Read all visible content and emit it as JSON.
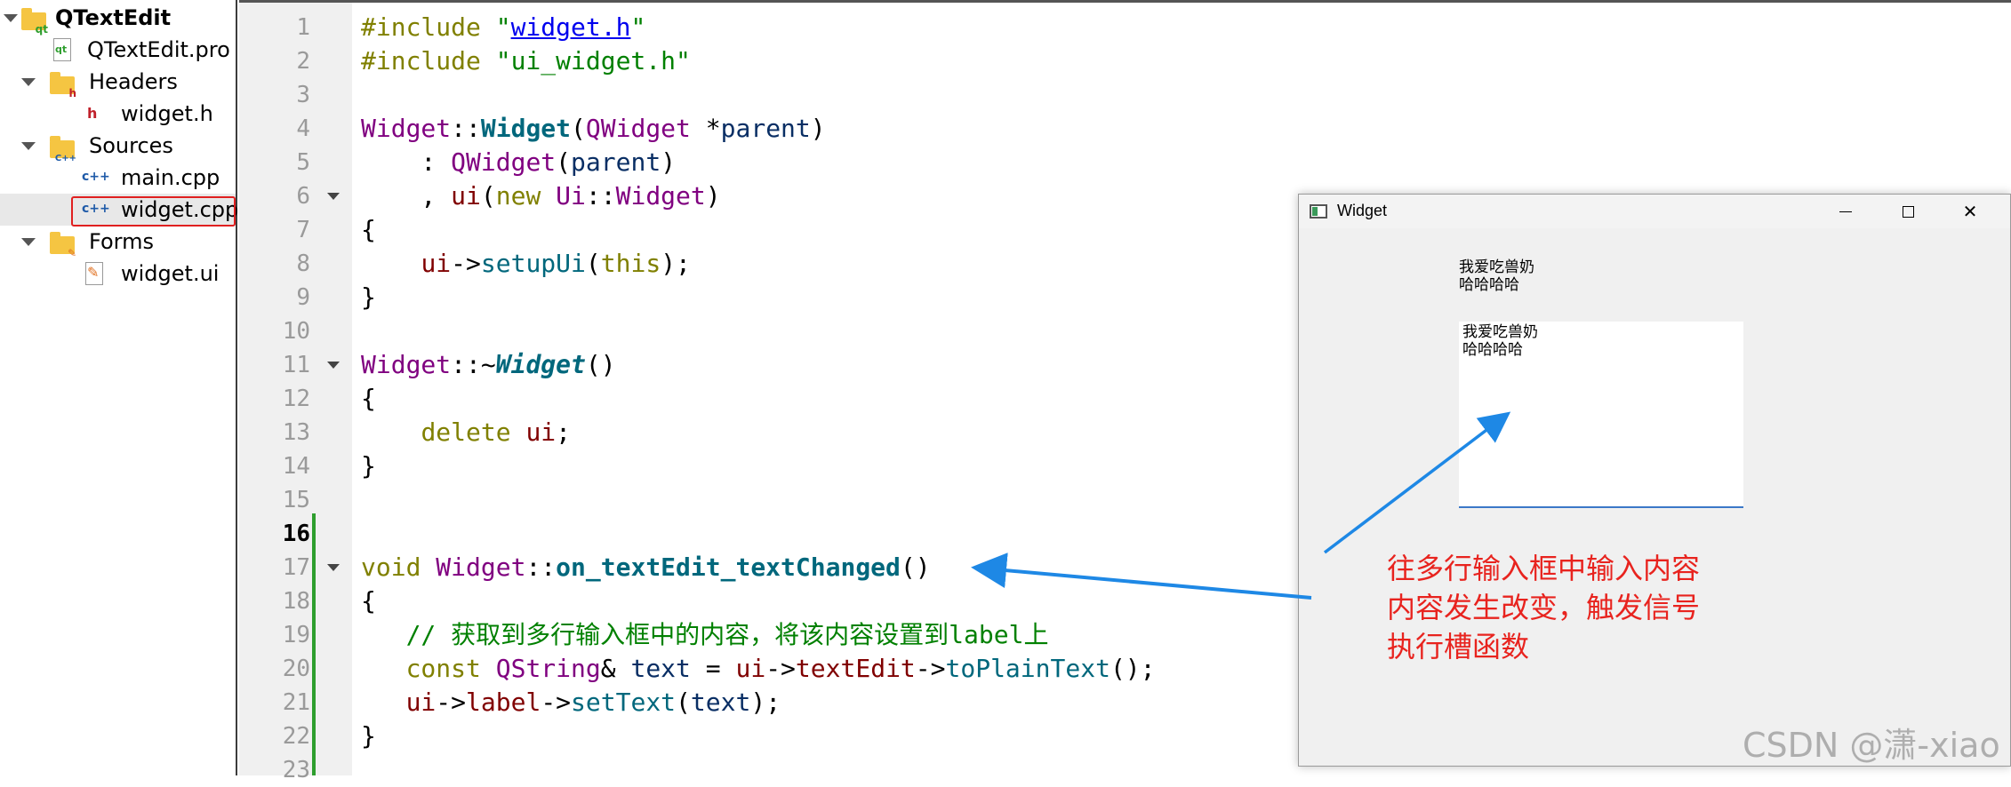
{
  "project_tree": {
    "items": [
      {
        "label": "QTextEdit",
        "kind": "project",
        "icon": "qt-folder-icon"
      },
      {
        "label": "QTextEdit.pro",
        "kind": "file",
        "icon": "qt-project-file-icon"
      },
      {
        "label": "Headers",
        "kind": "folder",
        "icon": "headers-folder-icon"
      },
      {
        "label": "widget.h",
        "kind": "file",
        "icon": "header-file-icon"
      },
      {
        "label": "Sources",
        "kind": "folder",
        "icon": "sources-folder-icon"
      },
      {
        "label": "main.cpp",
        "kind": "file",
        "icon": "cpp-file-icon"
      },
      {
        "label": "widget.cpp",
        "kind": "file",
        "icon": "cpp-file-icon",
        "selected": true
      },
      {
        "label": "Forms",
        "kind": "folder",
        "icon": "forms-folder-icon"
      },
      {
        "label": "widget.ui",
        "kind": "file",
        "icon": "ui-file-icon"
      }
    ]
  },
  "editor": {
    "line_numbers": [
      "1",
      "2",
      "3",
      "4",
      "5",
      "6",
      "7",
      "8",
      "9",
      "10",
      "11",
      "12",
      "13",
      "14",
      "15",
      "16",
      "17",
      "18",
      "19",
      "20",
      "21",
      "22",
      "23"
    ],
    "current_line": "16",
    "lines": [
      "#include \"widget.h\"",
      "#include \"ui_widget.h\"",
      "",
      "Widget::Widget(QWidget *parent)",
      "    : QWidget(parent)",
      "    , ui(new Ui::Widget)",
      "{",
      "    ui->setupUi(this);",
      "}",
      "",
      "Widget::~Widget()",
      "{",
      "    delete ui;",
      "}",
      "",
      "",
      "void Widget::on_textEdit_textChanged()",
      "{",
      "   // 获取到多行输入框中的内容，将该内容设置到label上",
      "   const QString& text = ui->textEdit->toPlainText();",
      "   ui->label->setText(text);",
      "}",
      ""
    ]
  },
  "widget_window": {
    "title": "Widget",
    "min_symbol": "",
    "max_symbol": "",
    "close_symbol": "✕",
    "label_line1": "我爱吃兽奶",
    "label_line2": "哈哈哈哈",
    "textedit_line1": "我爱吃兽奶",
    "textedit_line2": "哈哈哈哈"
  },
  "annotation": {
    "line1": "往多行输入框中输入内容",
    "line2": "内容发生改变，触发信号",
    "line3": "执行槽函数",
    "color": "#e8231e",
    "arrow_color": "#1e88e5"
  },
  "watermark": "CSDN @潇-xiao"
}
